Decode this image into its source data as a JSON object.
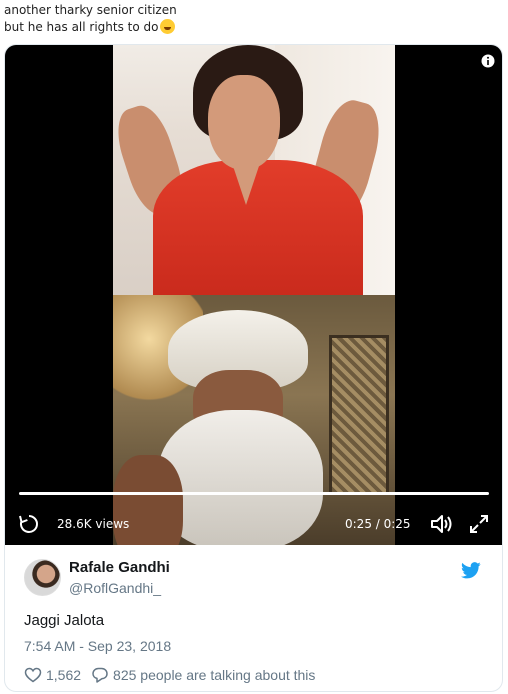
{
  "caption": {
    "line1": "another tharky senior citizen",
    "line2": "but he has all rights to do",
    "emoji": "laughing-face-emoji"
  },
  "video": {
    "views": "28.6K views",
    "time": "0:25 / 0:25",
    "progress_fraction": 1.0,
    "icons": [
      "replay-icon",
      "volume-icon",
      "fullscreen-icon",
      "info-icon"
    ]
  },
  "tweet": {
    "display_name": "Rafale Gandhi",
    "handle": "@RoflGandhi_",
    "text": "Jaggi Jalota",
    "timestamp": "7:54 AM - Sep 23, 2018",
    "likes": "1,562",
    "talking": "825 people are talking about this"
  },
  "colors": {
    "twitter_blue": "#1da1f2",
    "muted_text": "#657786",
    "border": "#e1e8ed"
  }
}
